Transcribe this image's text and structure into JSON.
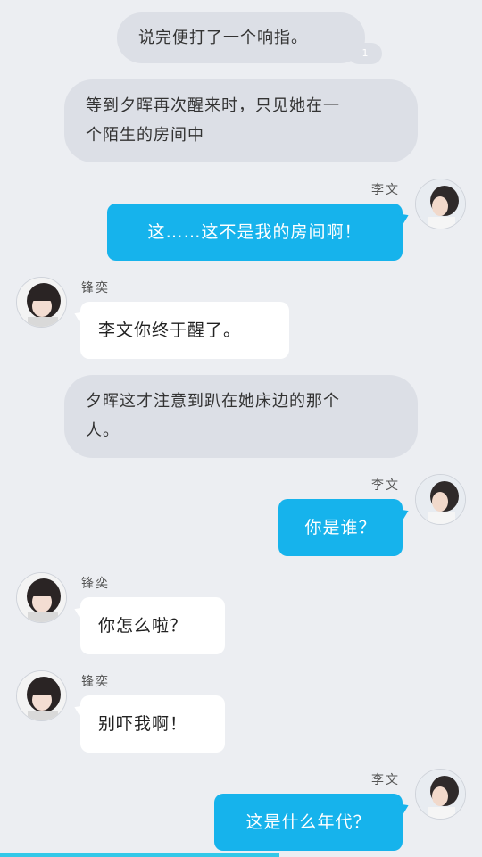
{
  "messages": [
    {
      "type": "narration",
      "text": "说完便打了一个响指。"
    },
    {
      "type": "narration_counter",
      "text": "1"
    },
    {
      "type": "narration",
      "text": "等到夕晖再次醒来时，只见她在一个陌生的房间中"
    },
    {
      "type": "right",
      "name": "李文",
      "text": "这……这不是我的房间啊！"
    },
    {
      "type": "left",
      "name": "锋奕",
      "text": "李文你终于醒了。"
    },
    {
      "type": "narration",
      "text": "夕晖这才注意到趴在她床边的那个人。"
    },
    {
      "type": "right",
      "name": "李文",
      "text": "你是谁？"
    },
    {
      "type": "left",
      "name": "锋奕",
      "text": "你怎么啦？"
    },
    {
      "type": "left",
      "name": "锋奕",
      "text": "别吓我啊！"
    },
    {
      "type": "right",
      "name": "李文",
      "text": "这是什么年代？"
    }
  ],
  "narration_line_1": "等到夕晖再次醒来时，只见她在一",
  "narration_line_2": "个陌生的房间中",
  "narration2_line_1": "夕晖这才注意到趴在她床边的那个",
  "narration2_line_2": "人。",
  "avatars": {
    "right": "girl-avatar-icon",
    "left": "girl-bangs-avatar-icon"
  },
  "colors": {
    "background": "#eceef2",
    "narration_bubble": "#dcdfe6",
    "right_bubble": "#16b3ec",
    "left_bubble": "#ffffff",
    "progress": "#33c8e8"
  },
  "progress": {
    "fraction": 0.58
  }
}
